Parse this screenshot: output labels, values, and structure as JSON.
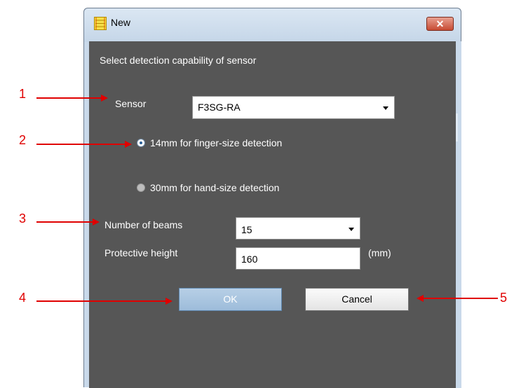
{
  "window": {
    "title": "New",
    "close_glyph": "✕"
  },
  "dialog": {
    "heading": "Select detection capability of sensor",
    "sensor_label": "Sensor",
    "sensor_value": "F3SG-RA",
    "radio_options": [
      {
        "label": "14mm for finger-size detection",
        "checked": true
      },
      {
        "label": "30mm for hand-size detection",
        "checked": false
      }
    ],
    "beams_label": "Number of beams",
    "beams_value": "15",
    "height_label": "Protective height",
    "height_value": "160",
    "height_unit": "(mm)",
    "ok_label": "OK",
    "cancel_label": "Cancel"
  },
  "callouts": [
    "1",
    "2",
    "3",
    "4",
    "5"
  ],
  "colors": {
    "callout": "#e00000",
    "client_bg": "#565656",
    "frame": "#c9d9ea",
    "close_button": "#c74b33"
  }
}
